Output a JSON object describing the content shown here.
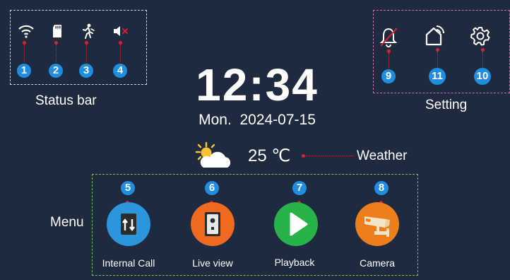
{
  "status_bar": {
    "title": "Status bar",
    "icons": [
      {
        "icon": "wifi-icon",
        "marker": "1"
      },
      {
        "icon": "sd-card-icon",
        "marker": "2"
      },
      {
        "icon": "motion-detection-icon",
        "marker": "3"
      },
      {
        "icon": "mute-icon",
        "marker": "4"
      }
    ]
  },
  "clock": {
    "time": "12:34",
    "date": "Mon.  2024-07-15"
  },
  "weather": {
    "icon": "partly-cloudy-icon",
    "temperature": "25 ℃",
    "label": "Weather"
  },
  "setting": {
    "title": "Setting",
    "icons": [
      {
        "icon": "bell-off-icon",
        "marker": "9"
      },
      {
        "icon": "home-wifi-icon",
        "marker": "11"
      },
      {
        "icon": "gear-icon",
        "marker": "10"
      }
    ]
  },
  "menu": {
    "title": "Menu",
    "items": [
      {
        "marker": "5",
        "label": "Internal Call",
        "icon": "internal-call-icon",
        "color": "#2b96dc"
      },
      {
        "marker": "6",
        "label": "Live view",
        "icon": "door-station-icon",
        "color": "#ef6a1e"
      },
      {
        "marker": "7",
        "label": "Playback",
        "icon": "play-icon",
        "color": "#27b34a"
      },
      {
        "marker": "8",
        "label": "Camera",
        "icon": "cctv-camera-icon",
        "color": "#ee7d1c"
      }
    ]
  },
  "colors": {
    "background": "#1d2a3f",
    "marker": "#1f8ee0",
    "pointer": "#e0202a",
    "status_box": "#cfd6df",
    "setting_box": "#d66ea8",
    "menu_box": "#78c251"
  }
}
